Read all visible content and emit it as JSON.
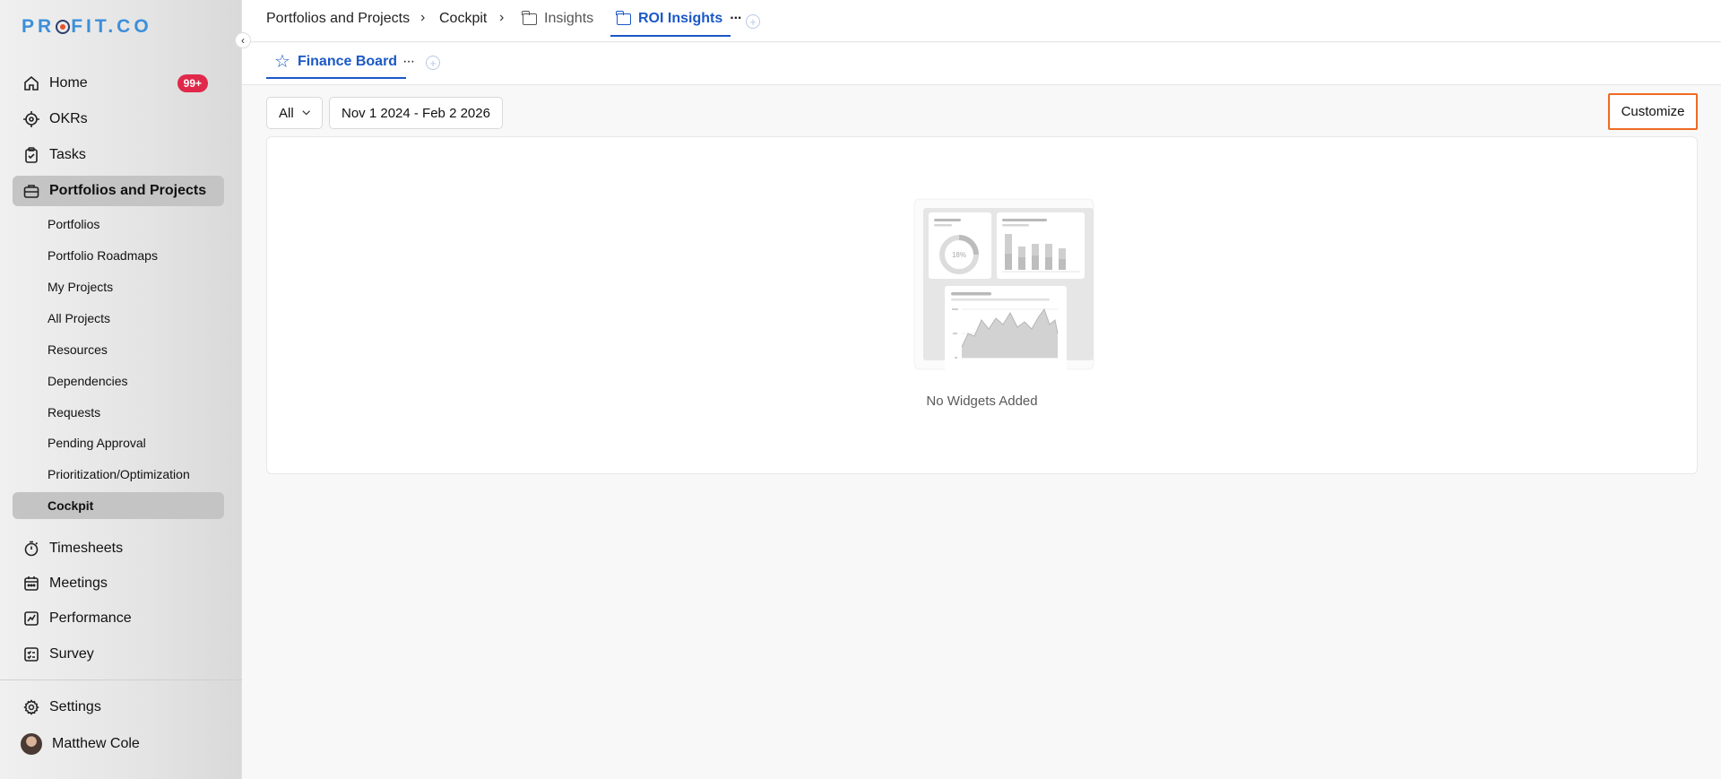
{
  "brand": {
    "logo_left": "PR",
    "logo_right": "FIT.CO"
  },
  "sidebar": {
    "collapse_icon": "chevron-left-icon",
    "main_items": [
      {
        "label": "Home",
        "icon": "home-icon",
        "badge": "99+"
      },
      {
        "label": "OKRs",
        "icon": "target-icon"
      },
      {
        "label": "Tasks",
        "icon": "clipboard-icon"
      },
      {
        "label": "Portfolios and Projects",
        "icon": "briefcase-icon",
        "active": true
      }
    ],
    "sub_items": [
      {
        "label": "Portfolios"
      },
      {
        "label": "Portfolio Roadmaps"
      },
      {
        "label": "My Projects"
      },
      {
        "label": "All Projects"
      },
      {
        "label": "Resources"
      },
      {
        "label": "Dependencies"
      },
      {
        "label": "Requests"
      },
      {
        "label": "Pending Approval"
      },
      {
        "label": "Prioritization/Optimization"
      },
      {
        "label": "Cockpit",
        "active": true
      }
    ],
    "lower_items": [
      {
        "label": "Timesheets",
        "icon": "stopwatch-icon"
      },
      {
        "label": "Meetings",
        "icon": "calendar-icon"
      },
      {
        "label": "Performance",
        "icon": "trend-chart-icon"
      },
      {
        "label": "Survey",
        "icon": "checklist-icon"
      }
    ],
    "settings": {
      "label": "Settings",
      "icon": "gear-icon"
    },
    "user": {
      "name": "Matthew Cole"
    }
  },
  "breadcrumb": {
    "items": [
      {
        "label": "Portfolios and Projects"
      },
      {
        "label": "Cockpit"
      },
      {
        "label": "Insights"
      },
      {
        "label": "ROI Insights",
        "active": true
      }
    ],
    "separator": "›",
    "more": "···"
  },
  "board": {
    "tab_label": "Finance Board",
    "more": "···"
  },
  "filters": {
    "scope": "All",
    "date_range": "Nov 1 2024 - Feb 2 2026"
  },
  "customize_label": "Customize",
  "empty_state": {
    "message": "No Widgets Added",
    "donut_label": "18%"
  },
  "colors": {
    "accent": "#1b58c6",
    "badge": "#e0294a",
    "highlight": "#f06a23",
    "logo": "#3d8fd9"
  }
}
